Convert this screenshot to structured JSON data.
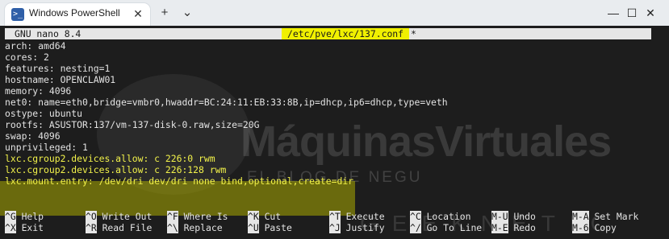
{
  "window": {
    "tab_title": "Windows PowerShell",
    "tab_icon": "powershell-icon",
    "tab_close": "✕",
    "new_tab": "+",
    "dropdown": "⌄",
    "minimize": "—",
    "maximize": "☐",
    "close": "✕"
  },
  "nano": {
    "version": "GNU nano 8.4",
    "filename": "/etc/pve/lxc/137.conf",
    "modified_marker": "*"
  },
  "file_lines": [
    "arch: amd64",
    "cores: 2",
    "features: nesting=1",
    "hostname: OPENCLAW01",
    "memory: 4096",
    "net0: name=eth0,bridge=vmbr0,hwaddr=BC:24:11:EB:33:8B,ip=dhcp,ip6=dhcp,type=veth",
    "ostype: ubuntu",
    "rootfs: ASUSTOR:137/vm-137-disk-0.raw,size=20G",
    "swap: 4096",
    "unprivileged: 1",
    "lxc.cgroup2.devices.allow: c 226:0 rwm",
    "lxc.cgroup2.devices.allow: c 226:128 rwm",
    "lxc.mount.entry: /dev/dri dev/dri none bind,optional,create=dir"
  ],
  "watermark": {
    "main": "MáquinasVirtuales",
    "sub": "EL BLOG DE NEGU",
    "brand": "GEEKNETIC"
  },
  "shortcuts_row1": [
    {
      "key": "^G",
      "label": "Help"
    },
    {
      "key": "^O",
      "label": "Write Out"
    },
    {
      "key": "^F",
      "label": "Where Is"
    },
    {
      "key": "^K",
      "label": "Cut"
    },
    {
      "key": "^T",
      "label": "Execute"
    },
    {
      "key": "^C",
      "label": "Location"
    },
    {
      "key": "M-U",
      "label": "Undo"
    },
    {
      "key": "M-A",
      "label": "Set Mark"
    }
  ],
  "shortcuts_row2": [
    {
      "key": "^X",
      "label": "Exit"
    },
    {
      "key": "^R",
      "label": "Read File"
    },
    {
      "key": "^\\",
      "label": "Replace"
    },
    {
      "key": "^U",
      "label": "Paste"
    },
    {
      "key": "^J",
      "label": "Justify"
    },
    {
      "key": "^/",
      "label": "Go To Line"
    },
    {
      "key": "M-E",
      "label": "Redo"
    },
    {
      "key": "M-6",
      "label": "Copy"
    }
  ],
  "colors": {
    "highlight": "#f0f000",
    "terminal_bg": "#1d1d1d"
  }
}
